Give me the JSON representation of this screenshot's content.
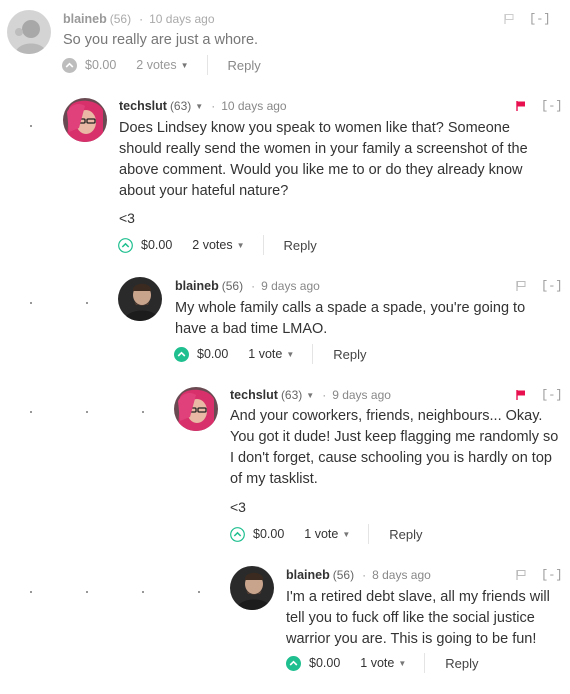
{
  "comments": [
    {
      "author": "blaineb",
      "reputation": "(56)",
      "time": "10 days ago",
      "body": "So you really are just a whore.",
      "payout": "$0.00",
      "votes": "2 votes",
      "reply_label": "Reply",
      "collapse_label": "[-]",
      "flagged": false
    },
    {
      "author": "techslut",
      "reputation": "(63)",
      "time": "10 days ago",
      "body": "Does Lindsey know you speak to women like that? Someone should really send the women in your family a screenshot of the above comment. Would you like me to or do they already know about your hateful nature?",
      "extra": "<3",
      "payout": "$0.00",
      "votes": "2 votes",
      "reply_label": "Reply",
      "collapse_label": "[-]",
      "flagged": true
    },
    {
      "author": "blaineb",
      "reputation": "(56)",
      "time": "9 days ago",
      "body": "My whole family calls a spade a spade, you're going to have a bad time LMAO.",
      "payout": "$0.00",
      "votes": "1 vote",
      "reply_label": "Reply",
      "collapse_label": "[-]",
      "flagged": false
    },
    {
      "author": "techslut",
      "reputation": "(63)",
      "time": "9 days ago",
      "body": "And your coworkers, friends, neighbours... Okay. You got it dude! Just keep flagging me randomly so I don't forget, cause schooling you is hardly on top of my tasklist.",
      "extra": "<3",
      "payout": "$0.00",
      "votes": "1 vote",
      "reply_label": "Reply",
      "collapse_label": "[-]",
      "flagged": true
    },
    {
      "author": "blaineb",
      "reputation": "(56)",
      "time": "8 days ago",
      "body": "I'm a retired debt slave, all my friends will tell you to fuck off like the social justice warrior you are. This is going to be fun!",
      "payout": "$0.00",
      "votes": "1 vote",
      "reply_label": "Reply",
      "collapse_label": "[-]",
      "flagged": false
    }
  ],
  "colors": {
    "upvote_active": "#1fbf8f",
    "upvote_outline": "#1fbf8f",
    "flag_active": "#e8104f",
    "flag_inactive": "#bbbbbb",
    "text": "#333333",
    "muted": "#999999"
  },
  "icons": {
    "upvote": "upvote-chevron-icon",
    "flag": "flag-icon",
    "dropdown": "caret-down-icon"
  }
}
